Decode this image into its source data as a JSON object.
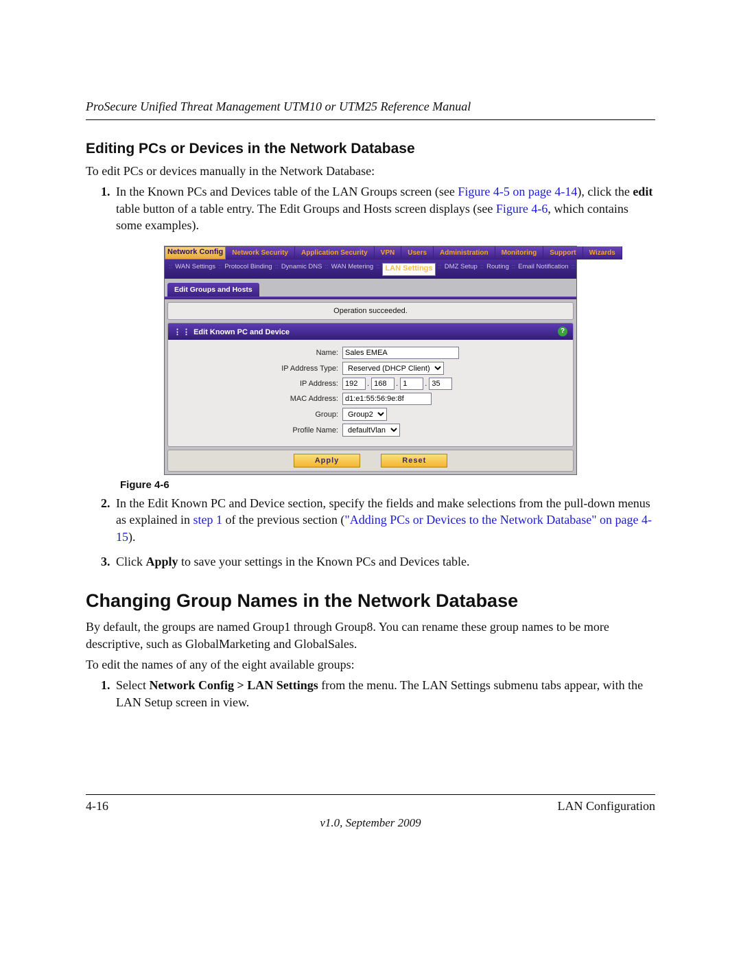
{
  "header": "ProSecure Unified Threat Management UTM10 or UTM25 Reference Manual",
  "section_title": "Editing PCs or Devices in the Network Database",
  "intro": "To edit PCs or devices manually in the Network Database:",
  "step1_a": "In the Known PCs and Devices table of the LAN Groups screen (see ",
  "step1_link1": "Figure 4-5 on page 4-14",
  "step1_b": "), click the ",
  "step1_bold": "edit",
  "step1_c": " table button of a table entry. The Edit Groups and Hosts screen displays (see ",
  "step1_link2": "Figure 4-6",
  "step1_d": ", which contains some examples).",
  "caption": "Figure 4-6",
  "step2_a": "In the Edit Known PC and Device section, specify the fields and make selections from the pull-down menus as explained in ",
  "step2_link1": "step 1",
  "step2_b": " of the previous section (",
  "step2_link2": "\"Adding PCs or Devices to the Network Database\" on page 4-15",
  "step2_c": ").",
  "step3_a": "Click ",
  "step3_bold": "Apply",
  "step3_b": " to save your settings in the Known PCs and Devices table.",
  "heading2": "Changing Group Names in the Network Database",
  "para_h2": "By default, the groups are named Group1 through Group8. You can rename these group names to be more descriptive, such as GlobalMarketing and GlobalSales.",
  "para_h2b": "To edit the names of any of the eight available groups:",
  "bstep1_a": "Select ",
  "bstep1_bold": "Network Config > LAN Settings",
  "bstep1_b": " from the menu. The LAN Settings submenu tabs appear, with the LAN Setup screen in view.",
  "footer_page": "4-16",
  "footer_section": "LAN Configuration",
  "footer_version": "v1.0, September 2009",
  "shot": {
    "tabs": [
      "Network Config",
      "Network Security",
      "Application Security",
      "VPN",
      "Users",
      "Administration",
      "Monitoring",
      "Support",
      "Wizards"
    ],
    "subtabs": [
      "WAN Settings",
      "Protocol Binding",
      "Dynamic DNS",
      "WAN Metering",
      "LAN Settings",
      "DMZ Setup",
      "Routing",
      "Email Notification"
    ],
    "section_tab": "Edit Groups and Hosts",
    "operation_msg": "Operation succeeded.",
    "panel_title": "Edit Known PC and Device",
    "form": {
      "name_label": "Name:",
      "name_value": "Sales EMEA",
      "iptype_label": "IP Address Type:",
      "iptype_value": "Reserved (DHCP Client)",
      "ip_label": "IP Address:",
      "ip": [
        "192",
        "168",
        "1",
        "35"
      ],
      "mac_label": "MAC Address:",
      "mac_value": "d1:e1:55:56:9e:8f",
      "group_label": "Group:",
      "group_value": "Group2",
      "profile_label": "Profile Name:",
      "profile_value": "defaultVlan"
    },
    "apply": "Apply",
    "reset": "Reset"
  }
}
